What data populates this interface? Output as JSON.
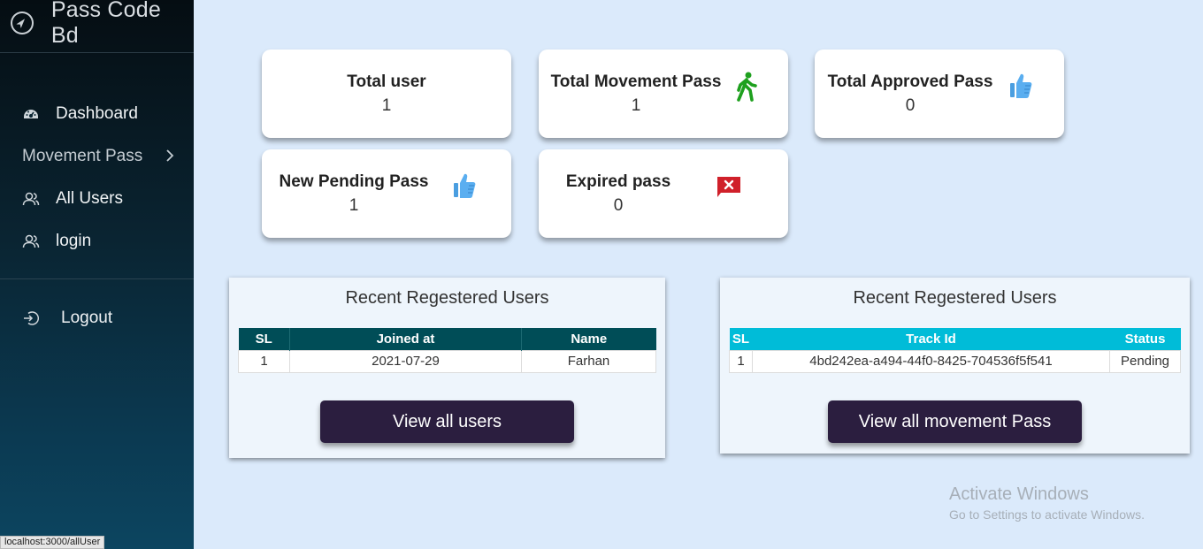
{
  "brand": {
    "title": "Pass Code Bd",
    "icon": "compass-icon"
  },
  "sidebar": {
    "items": [
      {
        "label": "Dashboard",
        "icon": "dashboard-icon"
      },
      {
        "label": "Movement Pass",
        "icon": "chevron-right-icon"
      },
      {
        "label": "All Users",
        "icon": "users-icon"
      },
      {
        "label": "login",
        "icon": "users-icon"
      }
    ],
    "logout": {
      "label": "Logout",
      "icon": "logout-icon"
    }
  },
  "stats": {
    "total_user": {
      "label": "Total user",
      "value": "1"
    },
    "total_movement": {
      "label": "Total Movement Pass",
      "value": "1",
      "icon": "walking-icon"
    },
    "total_approved": {
      "label": "Total Approved Pass",
      "value": "0",
      "icon": "thumbs-up-icon"
    },
    "new_pending": {
      "label": "New Pending Pass",
      "value": "1",
      "icon": "thumbs-up-icon"
    },
    "expired": {
      "label": "Expired pass",
      "value": "0",
      "icon": "expired-flag-icon"
    }
  },
  "users_panel": {
    "title": "Recent Regestered Users",
    "headers": [
      "SL",
      "Joined at",
      "Name"
    ],
    "rows": [
      [
        "1",
        "2021-07-29",
        "Farhan"
      ]
    ],
    "button": "View all users"
  },
  "passes_panel": {
    "title": "Recent Regestered Users",
    "headers": [
      "SL",
      "Track Id",
      "Status"
    ],
    "rows": [
      [
        "1",
        "4bd242ea-a494-44f0-8425-704536f5f541",
        "Pending"
      ]
    ],
    "button": "View all movement Pass"
  },
  "statusbar": "localhost:3000/allUser",
  "watermark": {
    "line1": "Activate Windows",
    "line2": "Go to Settings to activate Windows."
  },
  "colors": {
    "users_header": "#004d57",
    "passes_header": "#00bcd8",
    "button": "#2b1e3f",
    "background": "#dbeafb"
  }
}
